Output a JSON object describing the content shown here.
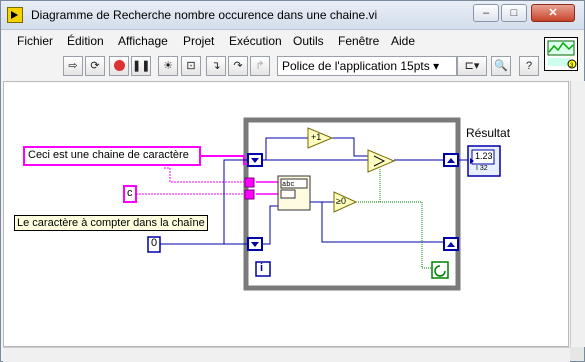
{
  "window": {
    "title": "Diagramme de Recherche nombre occurence dans une chaine.vi",
    "buttons": {
      "minimize": "–",
      "maximize": "□",
      "close": "✕"
    }
  },
  "menu": [
    "Fichier",
    "Édition",
    "Affichage",
    "Projet",
    "Exécution",
    "Outils",
    "Fenêtre",
    "Aide"
  ],
  "toolbar": {
    "font_select": "Police de l'application 15pts",
    "icons": [
      "run-arrow-icon",
      "run-continuous-icon",
      "abort-icon",
      "pause-icon",
      "highlight-execution-icon",
      "retain-wire-values-icon",
      "step-into-icon",
      "step-over-icon",
      "step-out-icon",
      "align-icon",
      "search-icon",
      "help-icon"
    ]
  },
  "diagram": {
    "string_constant_1": "Ceci est une chaine de caractère",
    "string_constant_2": "c",
    "label_char_to_count": "Le caractère à compter dans la chaîne",
    "numeric_constant": "0",
    "increment_label": "+1",
    "compare_label": "≥0",
    "result_label": "Résultat",
    "indicator_value": "1.23",
    "indicator_subtext": "I 32",
    "iteration_label": "i"
  },
  "colors": {
    "string_wire": "#ff00ff",
    "numeric_wire": "#0000aa",
    "loop_border": "#808080",
    "boolean_wire": "#008000"
  }
}
